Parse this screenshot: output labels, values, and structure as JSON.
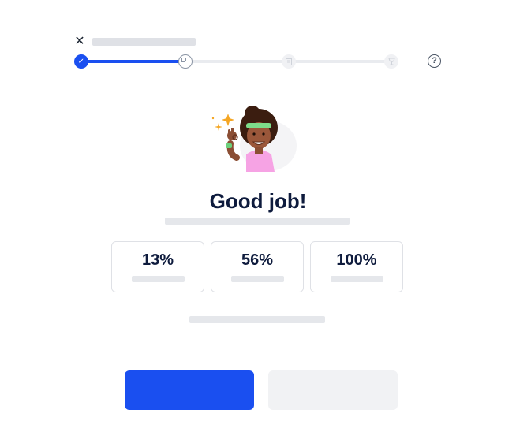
{
  "header": {
    "close_icon": "close-icon",
    "help_icon": "help-circle-icon",
    "help_glyph": "?"
  },
  "progress": {
    "completed_steps": 1,
    "current_step": 2,
    "total_steps": 4,
    "fill_fraction": 0.33,
    "steps": [
      {
        "state": "done",
        "icon": "check-icon"
      },
      {
        "state": "current",
        "icon": "translate-icon"
      },
      {
        "state": "upcoming",
        "icon": "document-icon"
      },
      {
        "state": "upcoming",
        "icon": "trophy-icon"
      }
    ]
  },
  "result": {
    "heading": "Good job!",
    "illustration": "celebrating-character-ok-gesture"
  },
  "stats": [
    {
      "value": "13%"
    },
    {
      "value": "56%"
    },
    {
      "value": "100%"
    }
  ],
  "colors": {
    "primary": "#1a4ff0",
    "text_dark": "#0e1b3d",
    "placeholder": "#e5e7eb",
    "secondary_button": "#f1f2f4"
  }
}
